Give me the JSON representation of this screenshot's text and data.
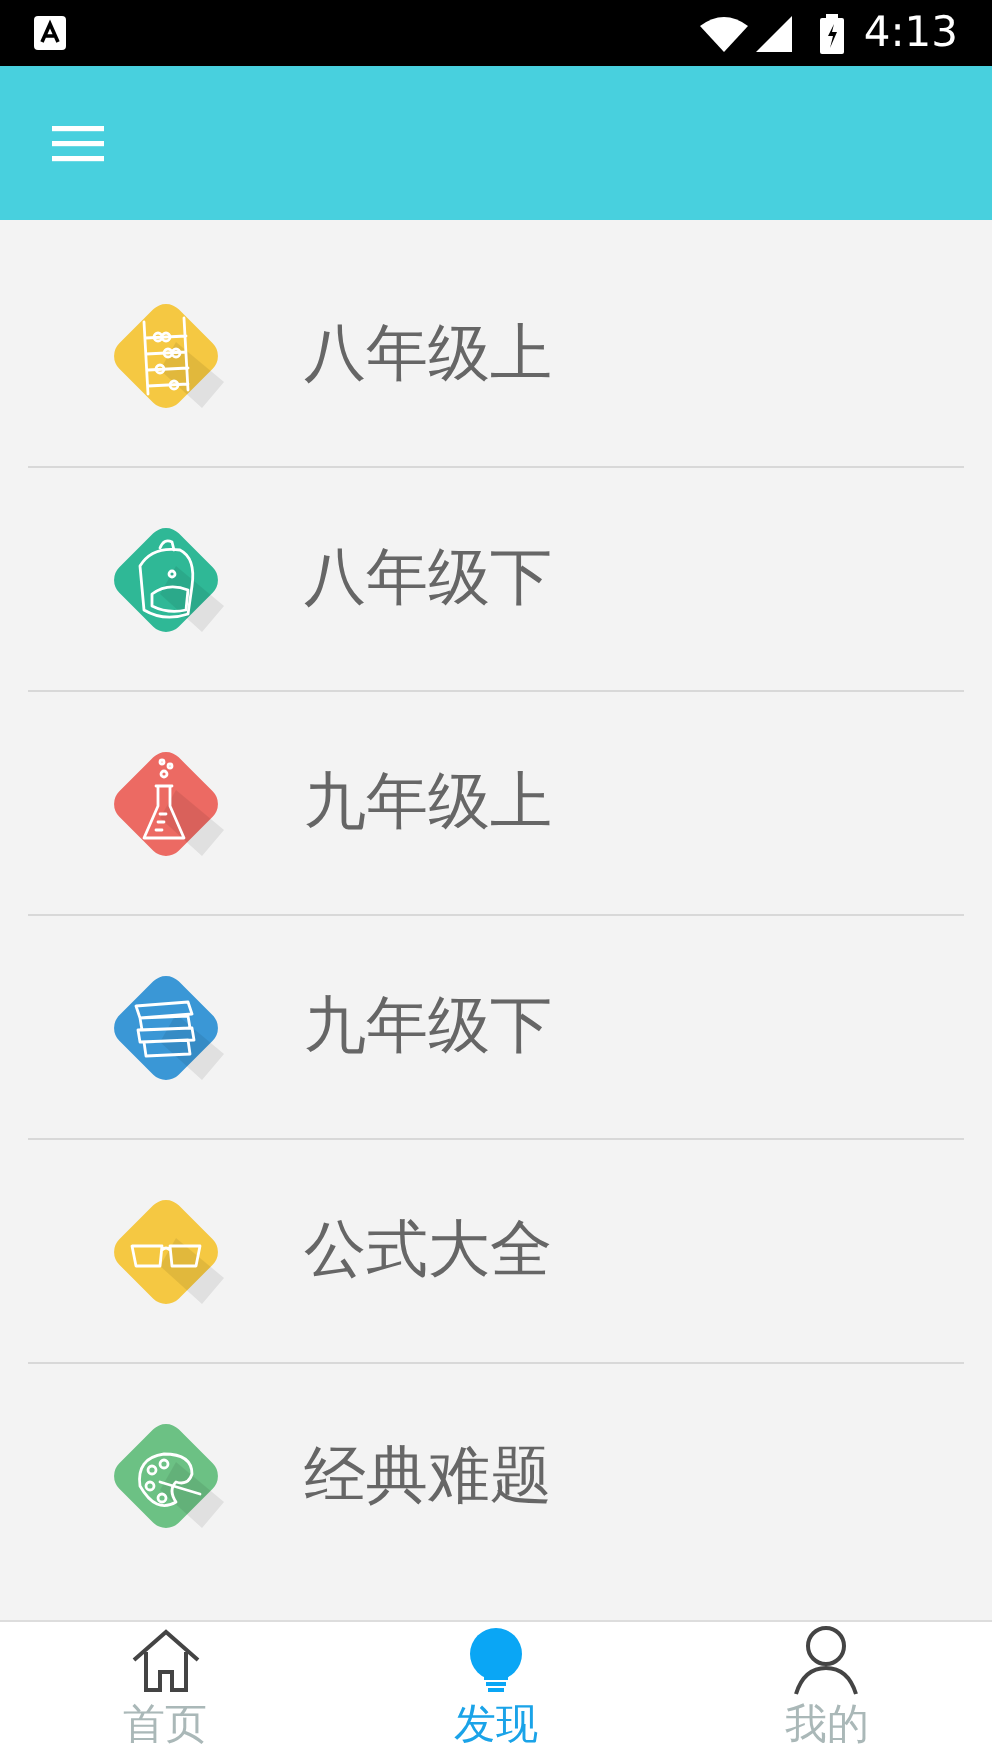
{
  "status_bar": {
    "time": "4:13"
  },
  "list": [
    {
      "label": "八年级上",
      "kind": "abacus",
      "color": "#f5c842"
    },
    {
      "label": "八年级下",
      "kind": "backpack",
      "color": "#2fb896"
    },
    {
      "label": "九年级上",
      "kind": "flask",
      "color": "#ec6a63"
    },
    {
      "label": "九年级下",
      "kind": "books",
      "color": "#3a97d6"
    },
    {
      "label": "公式大全",
      "kind": "glasses",
      "color": "#f5c842"
    },
    {
      "label": "经典难题",
      "kind": "palette",
      "color": "#6cc184"
    }
  ],
  "bottom_nav": [
    {
      "label": "首页",
      "kind": "home",
      "selected": false
    },
    {
      "label": "发现",
      "kind": "bulb",
      "selected": true
    },
    {
      "label": "我的",
      "kind": "person",
      "selected": false
    }
  ]
}
